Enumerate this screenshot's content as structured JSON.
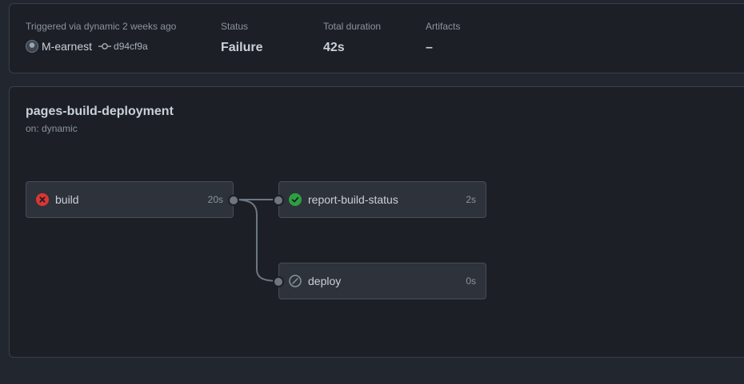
{
  "summary": {
    "trigger_label": "Triggered via dynamic 2 weeks ago",
    "actor": "M-earnest",
    "commit": "d94cf9a",
    "status_label": "Status",
    "status_value": "Failure",
    "duration_label": "Total duration",
    "duration_value": "42s",
    "artifacts_label": "Artifacts",
    "artifacts_value": "–"
  },
  "workflow": {
    "title": "pages-build-deployment",
    "trigger": "on: dynamic",
    "jobs": [
      {
        "name": "build",
        "duration": "20s",
        "status": "failure",
        "status_icon": "x-circle-icon",
        "status_color": "#da3633"
      },
      {
        "name": "report-build-status",
        "duration": "2s",
        "status": "success",
        "status_icon": "check-circle-icon",
        "status_color": "#2ea043"
      },
      {
        "name": "deploy",
        "duration": "0s",
        "status": "skipped",
        "status_icon": "skip-icon",
        "status_color": "#8b949e"
      }
    ]
  },
  "colors": {
    "background": "#22262e",
    "panel": "#1c1f26",
    "job_card": "#2d323b",
    "edge": "#6e7681"
  }
}
